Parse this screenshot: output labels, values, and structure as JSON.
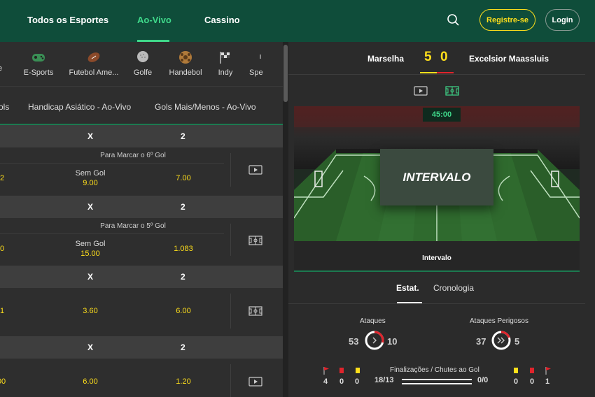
{
  "header": {
    "nav": [
      "Todos os Esportes",
      "Ao-Vivo",
      "Cassino"
    ],
    "register": "Registre-se",
    "login": "Login",
    "search_icon": "search-icon"
  },
  "colors": {
    "header_bg": "#0f4d3a",
    "accent_green": "#3fd88a",
    "odds_yellow": "#ffdf1b",
    "red": "#e0242c"
  },
  "sports": [
    {
      "label": "te",
      "icon": "football-icon"
    },
    {
      "label": "E-Sports",
      "icon": "gamepad-icon"
    },
    {
      "label": "Futebol Ame...",
      "icon": "american-football-icon"
    },
    {
      "label": "Golfe",
      "icon": "golf-ball-icon"
    },
    {
      "label": "Handebol",
      "icon": "handball-icon"
    },
    {
      "label": "Indy",
      "icon": "checkered-flag-icon"
    },
    {
      "label": "Spe",
      "icon": "speedway-icon"
    }
  ],
  "market_tabs": [
    "ols",
    "Handicap Asiático - Ao-Vivo",
    "Gols Mais/Menos - Ao-Vivo"
  ],
  "events": [
    {
      "head": {
        "x": "X",
        "two": "2"
      },
      "sub": "Para Marcar o 6º Gol",
      "col1": "2",
      "label": "Sem Gol",
      "col2": "9.00",
      "col3": "7.00",
      "icon": "video-icon"
    },
    {
      "head": {
        "x": "X",
        "two": "2"
      },
      "sub": "Para Marcar o 5º Gol",
      "col1": "0",
      "label": "Sem Gol",
      "col2": "15.00",
      "col3": "1.083",
      "icon": "pitch-icon"
    },
    {
      "head": {
        "x": "X",
        "two": "2"
      },
      "sub": "",
      "col1": "1",
      "label": "",
      "col2": "3.60",
      "col3": "6.00",
      "icon": "pitch-icon"
    },
    {
      "head": {
        "x": "X",
        "two": "2"
      },
      "sub": "",
      "col1": "00",
      "label": "",
      "col2": "6.00",
      "col3": "1.20",
      "icon": "video-icon"
    }
  ],
  "match": {
    "home": "Marselha",
    "away": "Excelsior Maassluis",
    "home_score": "5",
    "away_score": "0",
    "clock": "45:00",
    "overlay": "INTERVALO",
    "status": "Intervalo"
  },
  "stats_tabs": [
    "Estat.",
    "Cronologia"
  ],
  "stats": {
    "attacks_label": "Ataques",
    "attacks_home": "53",
    "attacks_away": "10",
    "dangerous_label": "Ataques Perigosos",
    "dangerous_home": "37",
    "dangerous_away": "5",
    "shots_label": "Finalizações / Chutes ao Gol",
    "shots_home": "18/13",
    "shots_away": "0/0",
    "home_corners": "4",
    "home_red": "0",
    "home_yellow": "0",
    "away_yellow": "0",
    "away_red": "0",
    "away_corners": "1"
  }
}
